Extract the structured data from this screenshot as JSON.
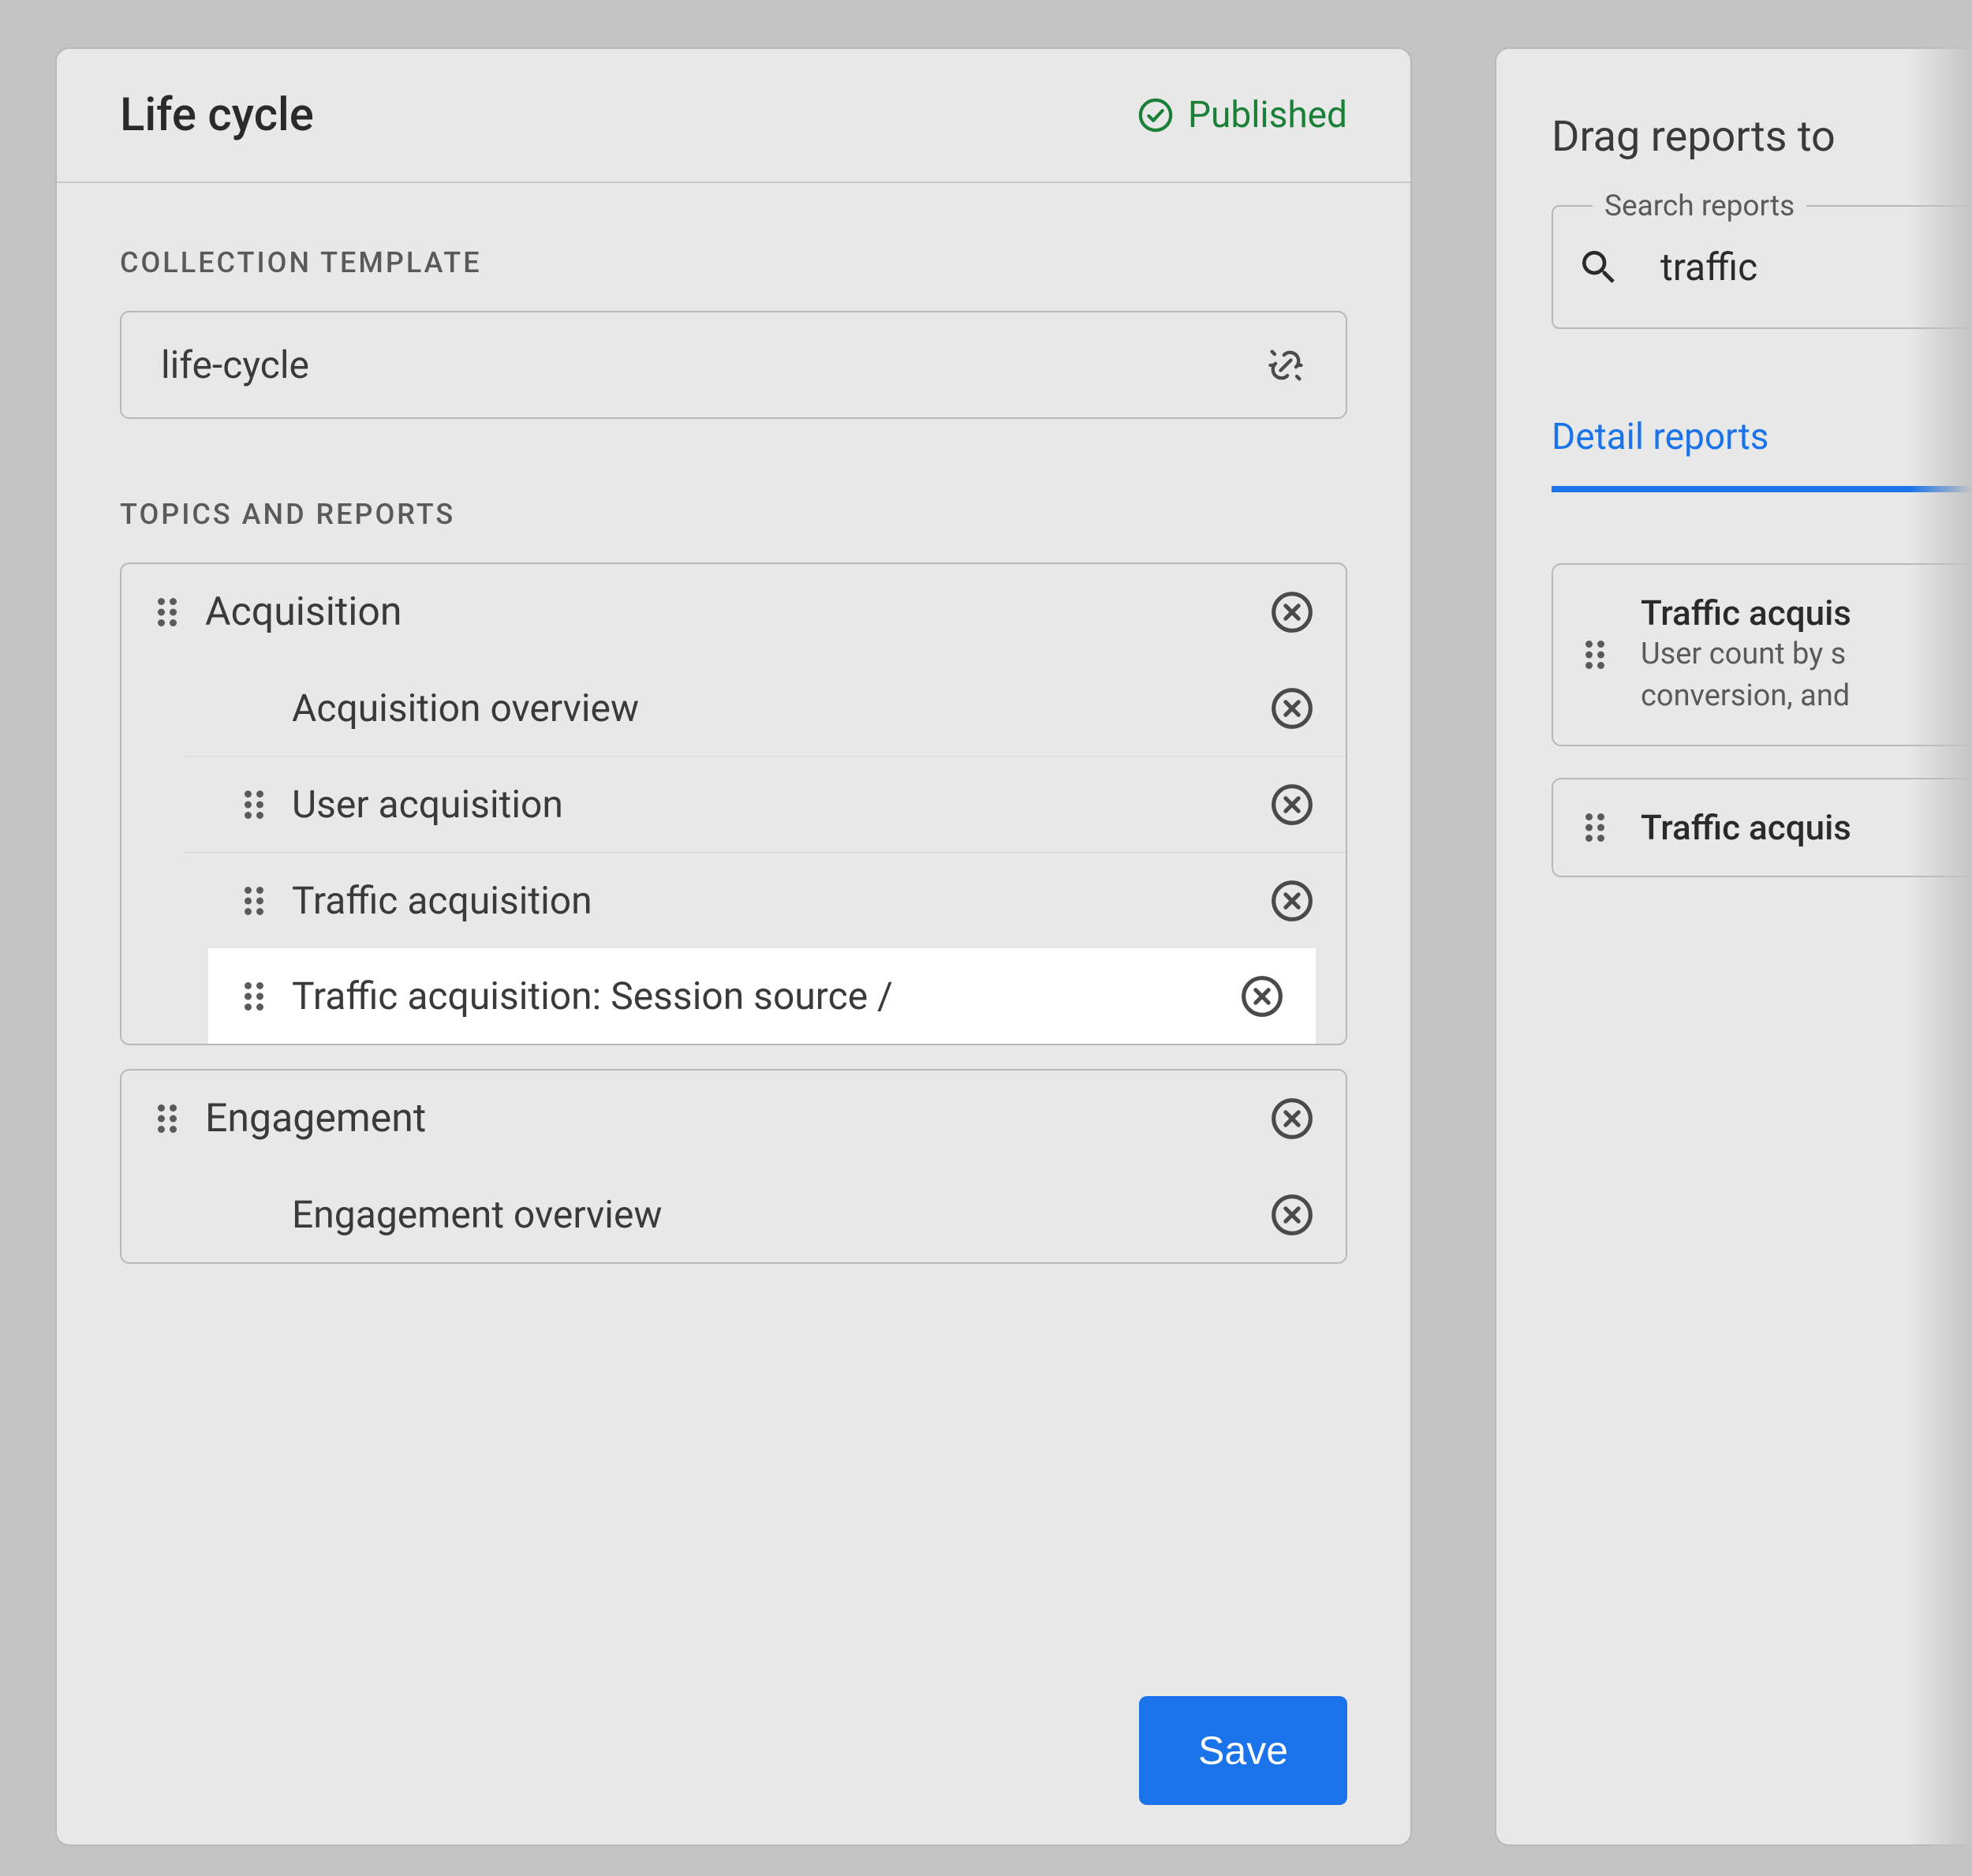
{
  "panel": {
    "title": "Life cycle",
    "status": "Published",
    "template_label": "COLLECTION TEMPLATE",
    "template_value": "life-cycle",
    "topics_label": "TOPICS AND REPORTS",
    "save_label": "Save"
  },
  "topics": [
    {
      "name": "Acquisition",
      "reports": [
        {
          "label": "Acquisition overview",
          "draggable": false,
          "highlighted": false
        },
        {
          "label": "User acquisition",
          "draggable": true,
          "highlighted": false
        },
        {
          "label": "Traffic acquisition",
          "draggable": true,
          "highlighted": false
        },
        {
          "label": "Traffic acquisition: Session source /",
          "draggable": true,
          "highlighted": true
        }
      ]
    },
    {
      "name": "Engagement",
      "reports": [
        {
          "label": "Engagement overview",
          "draggable": false,
          "highlighted": false
        }
      ]
    }
  ],
  "side": {
    "title": "Drag reports to",
    "search_label": "Search reports",
    "search_value": "traffic",
    "tab_label": "Detail reports",
    "cards": [
      {
        "title": "Traffic acquis",
        "desc1": "User count by s",
        "desc2": "conversion, and"
      },
      {
        "title": "Traffic acquis",
        "desc1": "",
        "desc2": ""
      }
    ]
  }
}
